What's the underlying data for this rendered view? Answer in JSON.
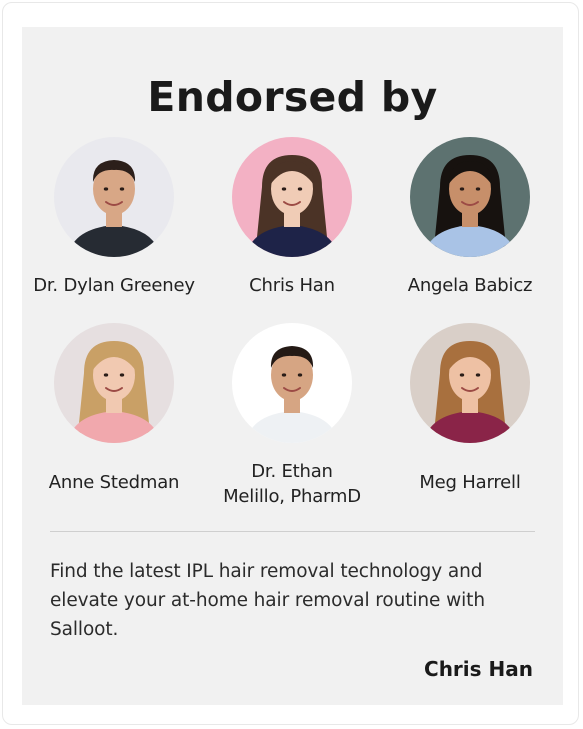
{
  "card": {
    "heading": "Endorsed by",
    "endorsers": [
      {
        "name": "Dr. Dylan Greeney",
        "bg": "#e9e9ee",
        "skin": "#d8a786",
        "hair": "#2c1f1a",
        "shirt": "#262b33"
      },
      {
        "name": "Chris Han",
        "bg": "#f3b1c4",
        "skin": "#f0ccb6",
        "hair": "#4b3326",
        "shirt": "#1e2348"
      },
      {
        "name": "Angela Babicz",
        "bg": "#5d7270",
        "skin": "#c78f6a",
        "hair": "#17120f",
        "shirt": "#a9c3e6"
      },
      {
        "name": "Anne Stedman",
        "bg": "#e6dfe0",
        "skin": "#f1c9b1",
        "hair": "#c9a066",
        "shirt": "#f1a8ad"
      },
      {
        "name": "Dr. Ethan Melillo, PharmD",
        "name_line1": "Dr. Ethan",
        "name_line2": "Melillo, PharmD",
        "bg": "#ffffff",
        "skin": "#d6a583",
        "hair": "#241a15",
        "shirt": "#eef1f4"
      },
      {
        "name": "Meg Harrell",
        "bg": "#d9cfc8",
        "skin": "#eec1a4",
        "hair": "#a8703e",
        "shirt": "#8a2448"
      }
    ],
    "quote": "Find the latest IPL hair removal technology and elevate your at-home hair removal routine with Salloot.",
    "author": "Chris Han"
  }
}
